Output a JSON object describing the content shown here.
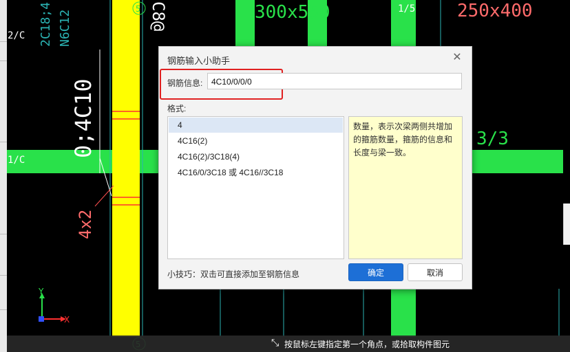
{
  "dialog": {
    "title": "钢筋输入小助手",
    "close_icon": "close-icon",
    "rebar_info_label": "钢筋信息:",
    "rebar_info_value": "4C10/0/0/0",
    "format_label": "格式:",
    "format_items": [
      {
        "label": "4",
        "selected": true
      },
      {
        "label": "4C16(2)",
        "selected": false
      },
      {
        "label": "4C16(2)/3C18(4)",
        "selected": false
      },
      {
        "label": "4C16/0/3C18 或 4C16//3C18",
        "selected": false
      }
    ],
    "description": "数量，表示次梁两侧共增加的箍筋数量，箍筋的信息和长度与梁一致。",
    "tip": "小技巧：双击可直接添加至钢筋信息",
    "ok_label": "确定",
    "cancel_label": "取消",
    "accent_color": "#1d6fd6",
    "highlight_color": "#e02020"
  },
  "canvas": {
    "labels": {
      "axis_5_top": "5",
      "axis_5_bottom": "5",
      "rebar_c8": "C8@",
      "beam_300x550": "300x550",
      "beam_250x400": "250x400",
      "fraction_1_5": "1/5",
      "fraction_3_3": "3/3",
      "rebar_main": "0;4C10",
      "stirrup_4x2": "4x2",
      "axis_2c": "2/C",
      "axis_1c": "1/C",
      "left_text_1": "2C18;4",
      "left_text_2": "N6C12",
      "axis_y": "Y",
      "axis_x": "X"
    },
    "beam_color": "#29e14a",
    "column_color": "#ffff00"
  },
  "status": {
    "icon": "crosshair-icon",
    "text": "按鼠标左键指定第一个角点，或拾取构件图元"
  }
}
